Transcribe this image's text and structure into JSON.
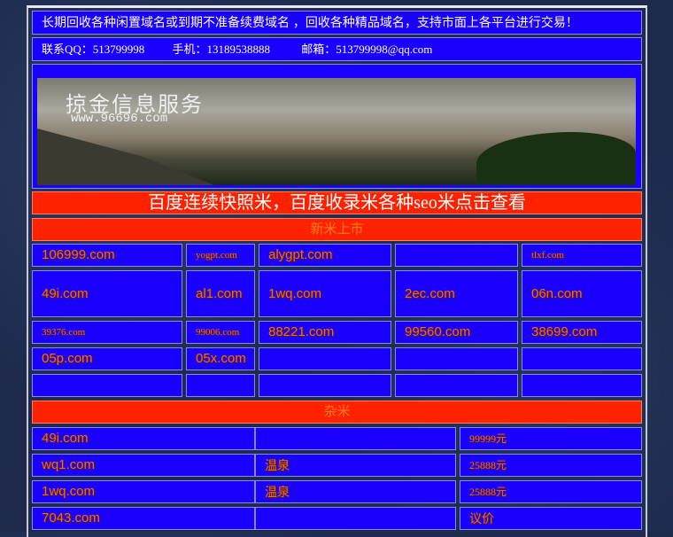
{
  "notice": "长期回收各种闲置域名或到期不准备续费域名 ，回收各种精品域名，支持市面上各平台进行交易！",
  "contact": {
    "qq": "联系QQ：513799998",
    "phone": "手机：13189538888",
    "email": "邮箱：513799998@qq.com"
  },
  "banner": {
    "title": "掠金信息服务",
    "url": "www.96696.com"
  },
  "promo": "百度连续快照米，百度收录米各种seo米点击查看",
  "section_new": "新米上市",
  "grid": [
    [
      "106999.com",
      "yogpt.com",
      "alygpt.com",
      "",
      "tlxf.com"
    ],
    [
      "49i.com",
      "al1.com",
      "1wq.com",
      "2ec.com",
      "06n.com"
    ],
    [
      "39376.com",
      "99006.com",
      "88221.com",
      "99560.com",
      "38699.com"
    ],
    [
      "05p.com",
      "05x.com",
      "",
      "",
      ""
    ],
    [
      "",
      "",
      "",
      "",
      ""
    ]
  ],
  "section_misc": "杂米",
  "misc": [
    {
      "domain": "49i.com",
      "desc": "",
      "price": "99999元"
    },
    {
      "domain": "wq1.com",
      "desc": "温泉",
      "price": "25888元"
    },
    {
      "domain": "1wq.com",
      "desc": "温泉",
      "price": "25888元"
    },
    {
      "domain": "7043.com",
      "desc": "",
      "price": "议价"
    }
  ]
}
